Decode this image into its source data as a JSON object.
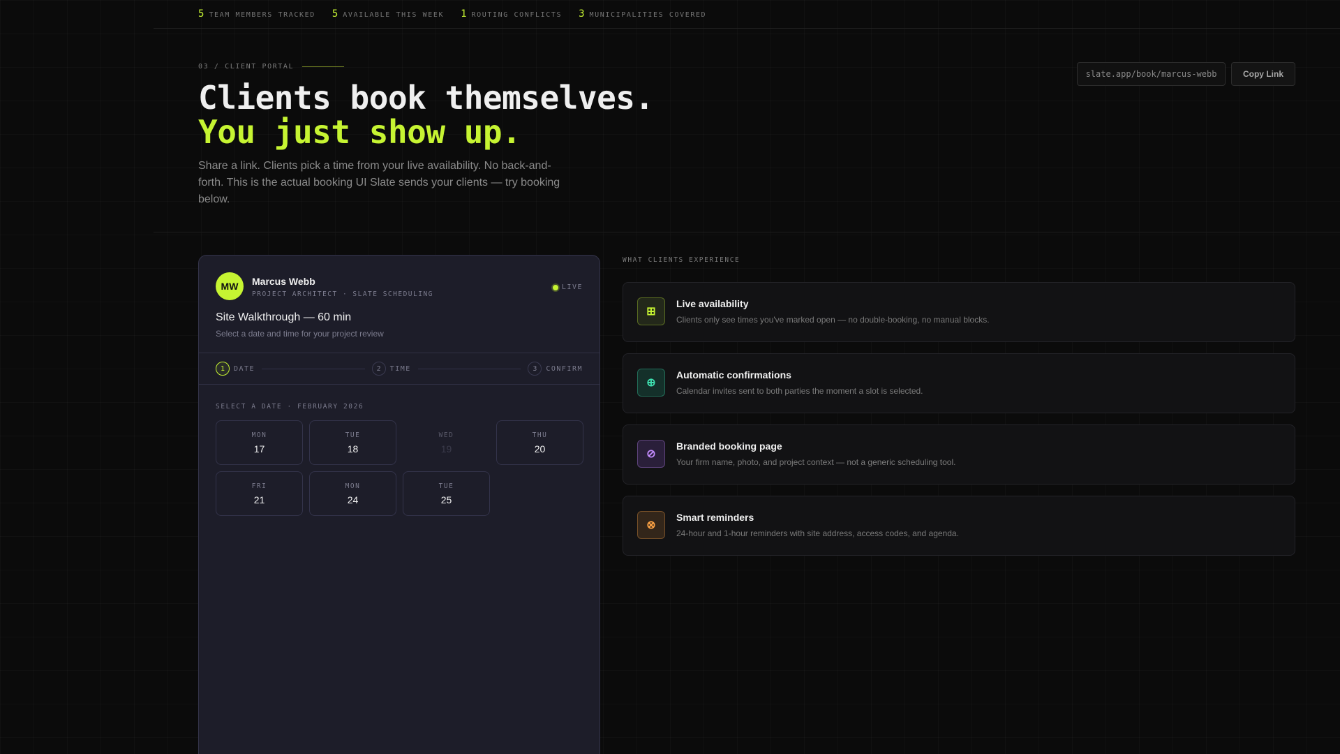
{
  "stats": [
    {
      "num": "5",
      "label": "TEAM MEMBERS TRACKED"
    },
    {
      "num": "5",
      "label": "AVAILABLE THIS WEEK"
    },
    {
      "num": "1",
      "label": "ROUTING CONFLICTS"
    },
    {
      "num": "3",
      "label": "MUNICIPALITIES COVERED"
    }
  ],
  "hero": {
    "section_label": "03 / CLIENT PORTAL",
    "title_line1": "Clients book themselves.",
    "title_line2": "You just show up.",
    "subtitle": "Share a link. Clients pick a time from your live availability. No back-and-forth. This is the actual booking UI Slate sends your clients — try booking below.",
    "link": "slate.app/book/marcus-webb",
    "copy_label": "Copy Link"
  },
  "booking": {
    "avatar_initials": "MW",
    "name": "Marcus Webb",
    "role": "PROJECT ARCHITECT · SLATE SCHEDULING",
    "live_label": "LIVE",
    "meeting_title": "Site Walkthrough — 60 min",
    "meeting_sub": "Select a date and time for your project review",
    "steps": [
      {
        "num": "1",
        "label": "DATE"
      },
      {
        "num": "2",
        "label": "TIME"
      },
      {
        "num": "3",
        "label": "CONFIRM"
      }
    ],
    "dates_label": "SELECT A DATE · FEBRUARY 2026",
    "dates": [
      {
        "dow": "MON",
        "day": "17"
      },
      {
        "dow": "TUE",
        "day": "18"
      },
      {
        "dow": "WED",
        "day": "19"
      },
      {
        "dow": "THU",
        "day": "20"
      },
      {
        "dow": "FRI",
        "day": "21"
      },
      {
        "dow": "MON",
        "day": "24"
      },
      {
        "dow": "TUE",
        "day": "25"
      }
    ]
  },
  "features": {
    "label": "WHAT CLIENTS EXPERIENCE",
    "items": [
      {
        "icon": "grid-icon",
        "glyph": "⊞",
        "title": "Live availability",
        "desc": "Clients only see times you've marked open — no double-booking, no manual blocks.",
        "color": "#c6f432",
        "bg": "#23281a"
      },
      {
        "icon": "plus-circle-icon",
        "glyph": "⊕",
        "title": "Automatic confirmations",
        "desc": "Calendar invites sent to both parties the moment a slot is selected.",
        "color": "#3ee0b0",
        "bg": "#14302a"
      },
      {
        "icon": "slash-circle-icon",
        "glyph": "⊘",
        "title": "Branded booking page",
        "desc": "Your firm name, photo, and project context — not a generic scheduling tool.",
        "color": "#c48cff",
        "bg": "#2a1f3a"
      },
      {
        "icon": "x-circle-icon",
        "glyph": "⊗",
        "title": "Smart reminders",
        "desc": "24-hour and 1-hour reminders with site address, access codes, and agenda.",
        "color": "#ffa445",
        "bg": "#33261a"
      }
    ]
  }
}
